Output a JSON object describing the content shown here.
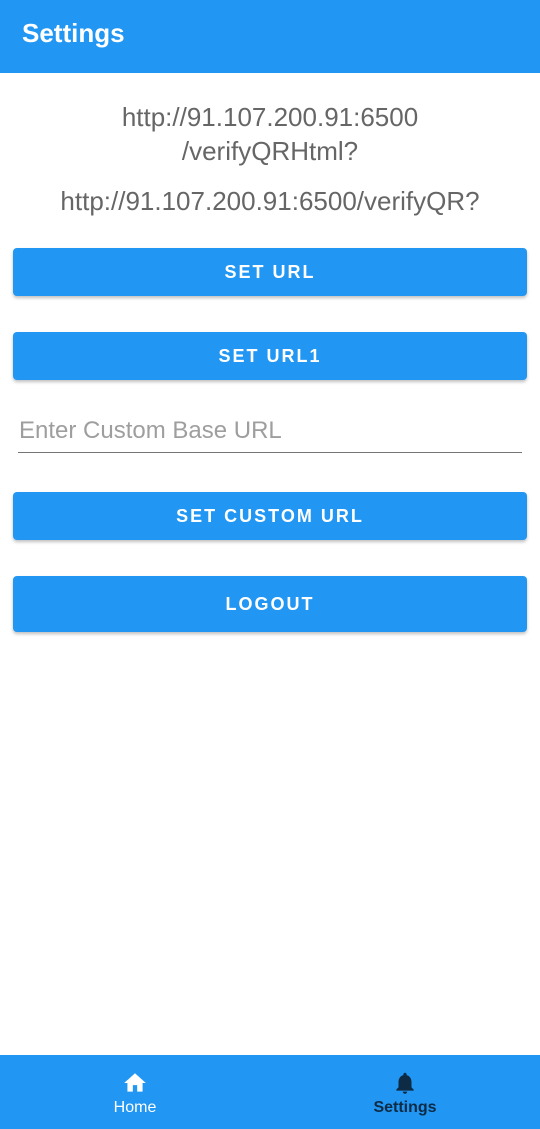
{
  "app_bar": {
    "title": "Settings"
  },
  "urls": {
    "primary_line1": "http://91.107.200.91:6500",
    "primary_line2": "/verifyQRHtml?",
    "secondary": "http://91.107.200.91:6500/verifyQR?"
  },
  "buttons": {
    "set_url": "SET URL",
    "set_url1": "SET URL1",
    "set_custom_url": "SET CUSTOM URL",
    "logout": "LOGOUT"
  },
  "custom_url_input": {
    "value": "",
    "placeholder": "Enter Custom Base URL"
  },
  "bottom_nav": {
    "items": [
      {
        "label": "Home",
        "icon": "home-icon",
        "active": false
      },
      {
        "label": "Settings",
        "icon": "bell-icon",
        "active": true
      }
    ]
  },
  "colors": {
    "primary": "#2196F3",
    "text_secondary": "#666666",
    "active_nav": "#0d2b45"
  }
}
